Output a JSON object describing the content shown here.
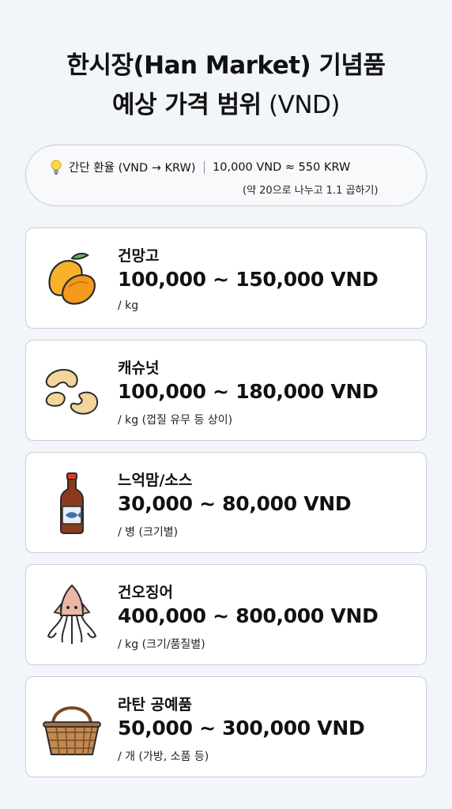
{
  "header": {
    "title_line1": "한시장(Han Market) 기념품",
    "title_line2_bold": "예상 가격 범위",
    "title_line2_light": " (VND)"
  },
  "exchange": {
    "icon": "lightbulb-icon",
    "label": "간단 환율 (VND → KRW)",
    "rate": "10,000 VND ≈ 550 KRW",
    "tip": "(약 20으로 나누고 1.1 곱하기)"
  },
  "items": [
    {
      "icon": "dried-mango-icon",
      "name": "건망고",
      "price": "100,000 ~ 150,000 VND",
      "unit": "/ kg"
    },
    {
      "icon": "cashew-icon",
      "name": "캐슈넛",
      "price": "100,000 ~ 180,000 VND",
      "unit": "/ kg (껍질 유무 등 상이)"
    },
    {
      "icon": "fish-sauce-bottle-icon",
      "name": "느억맘/소스",
      "price": "30,000 ~ 80,000 VND",
      "unit": "/ 병 (크기별)"
    },
    {
      "icon": "dried-squid-icon",
      "name": "건오징어",
      "price": "400,000 ~ 800,000 VND",
      "unit": "/ kg (크기/품질별)"
    },
    {
      "icon": "rattan-basket-icon",
      "name": "라탄 공예품",
      "price": "50,000 ~ 300,000 VND",
      "unit": "/ 개 (가방, 소품 등)"
    }
  ],
  "colors": {
    "background": "#f2f5f9",
    "card": "#ffffff",
    "border": "#c9ced5",
    "mango": "#f5a623",
    "cashew": "#f1d39a",
    "sauce": "#8b3a1e",
    "squid": "#e9b3a3",
    "rattan": "#b07a45"
  }
}
